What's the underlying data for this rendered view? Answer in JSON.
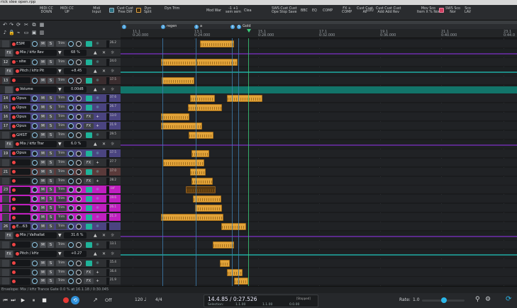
{
  "window": {
    "title": "rick slee open.rpp"
  },
  "toolbar": {
    "buttons": [
      {
        "label": "MIDI CC\nDOWN"
      },
      {
        "label": "MIDI CC\nUP"
      },
      {
        "label": "Midi\nInput"
      },
      {
        "label": "Cust Cust\nFree Diff"
      },
      {
        "label": "Dyn\nSplit"
      },
      {
        "label": "Dyn Trim"
      },
      {
        "label": "Mod War"
      },
      {
        "label": "-1 +1\nsem sem"
      },
      {
        "label": "Clea"
      },
      {
        "label": "SWS Cust Cust\nOpe Stop Save"
      },
      {
        "label": "BBC"
      },
      {
        "label": "EQ"
      },
      {
        "label": "COMP"
      },
      {
        "label": "FX +\nCOMP"
      },
      {
        "label": "Cust Cust\nAll"
      },
      {
        "label": "LOU"
      },
      {
        "label": "Cust Cust Cust\nAdd Add Rev"
      },
      {
        "label": "Mov Sco\nItem X % Nor"
      },
      {
        "label": "SWS Sco\nNor"
      },
      {
        "label": "Sco\nLAV"
      }
    ]
  },
  "ruler": {
    "markers": [
      {
        "num": "1",
        "label": ""
      },
      {
        "num": "2",
        "label": "regen"
      },
      {
        "num": "3",
        "label": "a"
      },
      {
        "num": "4",
        "label": ""
      },
      {
        "num": "5",
        "label": "Gold"
      }
    ],
    "ticks": [
      {
        "bar": "11.1",
        "time": "0:20.000"
      },
      {
        "bar": "13.1",
        "time": "0:24.000"
      },
      {
        "bar": "15.1",
        "time": "0:28.000"
      },
      {
        "bar": "17.1",
        "time": "0:32.000"
      },
      {
        "bar": "19.1",
        "time": "0:36.000"
      },
      {
        "bar": "21.1",
        "time": "0:40.000"
      },
      {
        "bar": "23.1",
        "time": "0:44.0"
      }
    ]
  },
  "tracks": [
    {
      "kind": "track",
      "num": "",
      "name": "ESM",
      "color": "#2e3033",
      "trim": "Trim",
      "fx": "",
      "val": "26.2"
    },
    {
      "kind": "env",
      "tag": "FX",
      "name": "Mix / kHz Rev",
      "value": "68 %"
    },
    {
      "kind": "track",
      "num": "12",
      "name": "- site",
      "color": "#2e3033",
      "trim": "Trim",
      "fx": "",
      "val": "24.0"
    },
    {
      "kind": "env",
      "tag": "FX",
      "name": "Pitch / kHz Pit",
      "value": "+8.45"
    },
    {
      "kind": "track",
      "num": "13",
      "name": "",
      "color": "#3a2c2e",
      "trim": "Trim",
      "fx": "",
      "val": "17.5"
    },
    {
      "kind": "env",
      "tag": "",
      "name": "Volume",
      "value": "0.00dB"
    },
    {
      "kind": "track",
      "num": "14",
      "name": "Opus",
      "color": "#4a4480",
      "trim": "Trim",
      "fx": "",
      "val": "37.6"
    },
    {
      "kind": "track",
      "num": "15",
      "name": "Opus",
      "color": "#4a4480",
      "trim": "Trim",
      "fx": "",
      "val": "26.7"
    },
    {
      "kind": "track",
      "num": "16",
      "name": "Opus",
      "color": "#4a4480",
      "trim": "Trim",
      "fx": "FX",
      "val": "13.0"
    },
    {
      "kind": "track",
      "num": "17",
      "name": "Opus",
      "color": "#4a4480",
      "trim": "Trim",
      "fx": "FX",
      "val": "21.9"
    },
    {
      "kind": "track",
      "num": "",
      "name": "GHST",
      "color": "#2e3033",
      "trim": "Trim",
      "fx": "",
      "val": "29.5"
    },
    {
      "kind": "env",
      "tag": "FX",
      "name": "Mix / kHz Trar",
      "value": "6.0 %"
    },
    {
      "kind": "track",
      "num": "19",
      "name": "Opus",
      "color": "#4a4480",
      "trim": "Trim",
      "fx": "",
      "val": "17.5"
    },
    {
      "kind": "track",
      "num": "",
      "name": "",
      "color": "#2e3033",
      "trim": "Trim",
      "fx": "FX",
      "val": "27.7"
    },
    {
      "kind": "track",
      "num": "21",
      "name": "",
      "color": "#5a3a3a",
      "trim": "Trim",
      "fx": "",
      "val": "17.0"
    },
    {
      "kind": "track",
      "num": "",
      "name": "",
      "color": "#2e3033",
      "trim": "Trim",
      "fx": "FX",
      "val": "28.2"
    },
    {
      "kind": "track",
      "num": "23",
      "name": "",
      "color": "#c020c0",
      "trim": "Trim",
      "fx": "",
      "val": "-inf"
    },
    {
      "kind": "track",
      "num": "",
      "name": "",
      "color": "#c020c0",
      "trim": "Trim",
      "fx": "",
      "val": "19.6"
    },
    {
      "kind": "track",
      "num": "",
      "name": "",
      "color": "#c020c0",
      "trim": "Trim",
      "fx": "",
      "val": "26.1"
    },
    {
      "kind": "track",
      "num": "",
      "name": "",
      "color": "#c020c0",
      "trim": "Trim",
      "fx": "",
      "val": "21.3"
    },
    {
      "kind": "track",
      "num": "26",
      "name": "E...63",
      "color": "#4a4480",
      "trim": "Trim",
      "fx": "",
      "val": ""
    },
    {
      "kind": "env",
      "tag": "FX",
      "name": "Mix / Valhallat",
      "value": "31.6 %"
    },
    {
      "kind": "track",
      "num": "",
      "name": "",
      "color": "#2e3033",
      "trim": "Trim",
      "fx": "",
      "val": "13.1"
    },
    {
      "kind": "env",
      "tag": "FX",
      "name": "Pitch / kHz",
      "value": "+0.27"
    },
    {
      "kind": "track",
      "num": "",
      "name": "",
      "color": "#2e3033",
      "trim": "Trim",
      "fx": "",
      "val": "15.4"
    },
    {
      "kind": "track",
      "num": "",
      "name": "",
      "color": "#2e3033",
      "trim": "Trim",
      "fx": "FX",
      "val": "16.4"
    },
    {
      "kind": "track",
      "num": "",
      "name": "",
      "color": "#2e3033",
      "trim": "Trim",
      "fx": "FX",
      "val": "21.9"
    },
    {
      "kind": "track",
      "num": "",
      "name": "",
      "color": "#2e3033",
      "trim": "Trim",
      "fx": "FX",
      "val": "16.5"
    },
    {
      "kind": "track",
      "num": "",
      "name": "",
      "color": "#2e3033",
      "trim": "Trim",
      "fx": "FX",
      "val": ""
    }
  ],
  "transport": {
    "status": "Envelope: Mix / kHz Trance Gate 0.0 % at 16.1.18 / 0:30.045",
    "loop_label": "Off",
    "tempo": "120",
    "timesig": "4/4",
    "position": "14.4.85 / 0:27.526",
    "stopped": "[Stopped]",
    "selection_label": "Selection:",
    "sel_start": "1.1.00",
    "sel_end": "1.1.00",
    "sel_len": "0.0.00",
    "rate_label": "Rate:",
    "rate": "1.0"
  }
}
